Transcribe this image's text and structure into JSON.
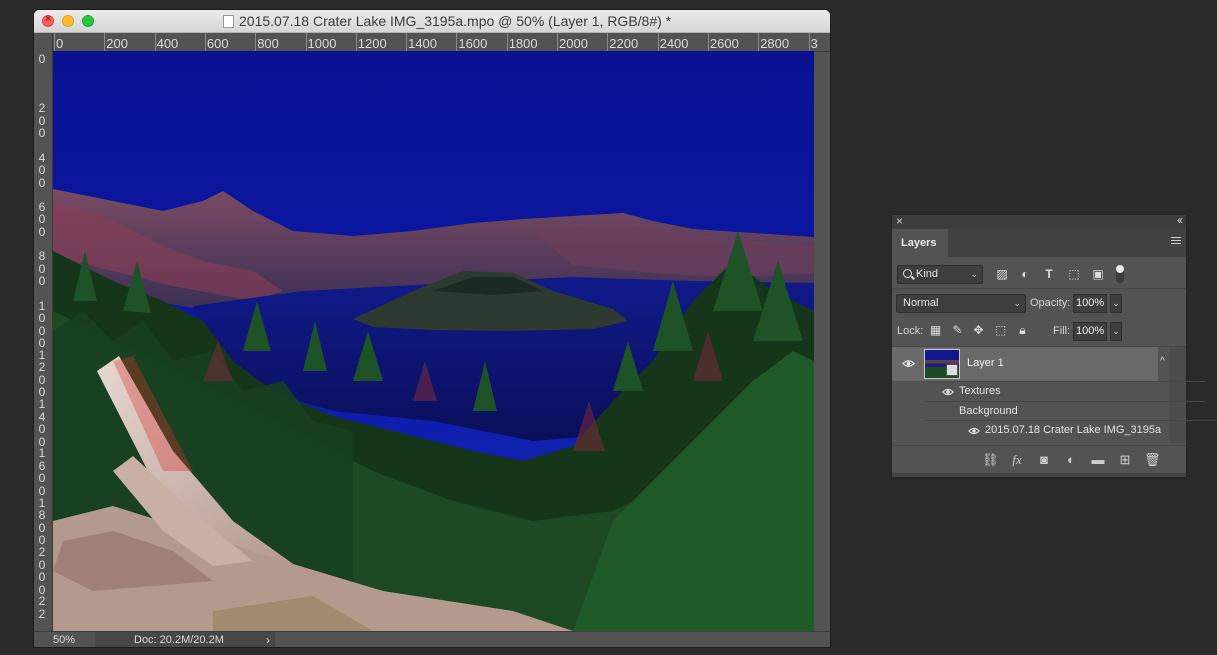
{
  "document_window": {
    "title": "2015.07.18 Crater Lake IMG_3195a.mpo @ 50% (Layer 1, RGB/8#) *",
    "ruler_top_labels": [
      "0",
      "200",
      "400",
      "600",
      "800",
      "1000",
      "1200",
      "1400",
      "1600",
      "1800",
      "2000",
      "2200",
      "2400",
      "2600",
      "2800",
      "3"
    ],
    "ruler_left_labels": [
      "0",
      "2 0 0",
      "4 0 0",
      "6 0 0",
      "8 0 0",
      "1 0 0 0",
      "1 2 0 0",
      "1 4 0 0",
      "1 6 0 0",
      "1 8 0 0",
      "2 0 0 0",
      "2 2"
    ],
    "status": {
      "zoom": "50%",
      "doc_size": "Doc: 20.2M/20.2M",
      "arrow": "›"
    }
  },
  "layers_panel": {
    "close_glyph": "×",
    "collapse_glyph": "‹‹",
    "tab_label": "Layers",
    "filter_kind": "Kind",
    "blend_mode": "Normal",
    "opacity_label": "Opacity:",
    "opacity_value": "100%",
    "lock_label": "Lock:",
    "fill_label": "Fill:",
    "fill_value": "100%",
    "layer": {
      "name": "Layer 1",
      "filters": [
        {
          "label": "Textures",
          "visible": true
        },
        {
          "label": "Background",
          "visible": false
        },
        {
          "label": "2015.07.18 Crater Lake IMG_3195a",
          "visible": true
        }
      ]
    },
    "footer_icons": [
      "link-icon",
      "fx-icon",
      "mask-icon",
      "adjustment-icon",
      "folder-icon",
      "new-layer-icon",
      "trash-icon"
    ]
  },
  "colors": {
    "window_bg": "#535353",
    "desktop_bg": "#2a2a2a",
    "selected_layer": "#696969"
  }
}
